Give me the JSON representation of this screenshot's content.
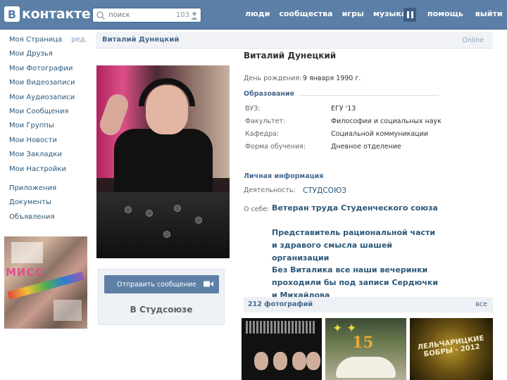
{
  "header": {
    "logo_letter": "В",
    "logo_text": "контакте",
    "search_placeholder": "поиск",
    "search_count": "103",
    "nav": [
      "люди",
      "сообщества",
      "игры",
      "музыка"
    ],
    "nav_right": [
      "помощь",
      "выйти"
    ]
  },
  "sidebar": {
    "items": [
      {
        "label": "Моя Страница",
        "extra": "ред."
      },
      {
        "label": "Мои Друзья"
      },
      {
        "label": "Мои Фотографии"
      },
      {
        "label": "Мои Видеозаписи"
      },
      {
        "label": "Мои Аудиозаписи"
      },
      {
        "label": "Мои Сообщения"
      },
      {
        "label": "Мои Группы"
      },
      {
        "label": "Мои Новости"
      },
      {
        "label": "Мои Закладки"
      },
      {
        "label": "Мои Настройки"
      }
    ],
    "items2": [
      {
        "label": "Приложения"
      },
      {
        "label": "Документы"
      },
      {
        "label": "Объявления"
      }
    ],
    "ad_text": "МИСС"
  },
  "profile": {
    "bar_name": "Виталий Дунецкий",
    "status": "Online",
    "name": "Виталий  Дунецкий",
    "birthday_label": "День рождения:",
    "birthday_value": "9 января 1990 г.",
    "education_title": "Образование",
    "education": [
      {
        "label": "ВУЗ:",
        "value": "ЕГУ '13"
      },
      {
        "label": "Факультет:",
        "value": "Философии и социальных наук"
      },
      {
        "label": "Кафедра:",
        "value": "Социальной коммуникации"
      },
      {
        "label": "Форма обучения:",
        "value": "Дневное отделение"
      }
    ],
    "personal_title": "Личная информация",
    "activity_label": "Деятельность:",
    "activity_value": "СТУДСОЮЗ",
    "about_label": "О себе:",
    "about_lines": [
      "Ветеран труда Студенческого союза",
      "Представитель рациональной части и здравого смысла шашей организации",
      "Без Виталика все наши вечеринки проходили бы под записи Сердючки и Михайлова"
    ],
    "message_button": "Отправить сообщение",
    "group_name": "В Студсоюзе"
  },
  "photos": {
    "title": "212 фотографий",
    "all": "все",
    "thumb2_num": "15",
    "thumb3_text": "ЛЕЛЬЧАРИЦКИЕ БОБРЫ - 2012"
  },
  "colors": {
    "header_bg": "#5b7fa6",
    "link": "#2b587a",
    "button": "#5e80a6"
  },
  "icons": [
    "search-icon",
    "user-icon",
    "pause-icon",
    "camera-icon"
  ]
}
